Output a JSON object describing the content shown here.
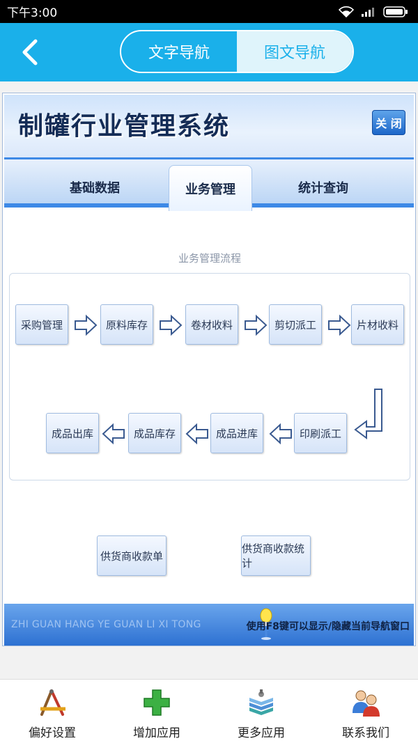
{
  "status_bar": {
    "time": "下午3:00"
  },
  "header": {
    "tabs": [
      {
        "label": "文字导航",
        "active": false
      },
      {
        "label": "图文导航",
        "active": true
      }
    ]
  },
  "system": {
    "title": "制罐行业管理系统",
    "close_label": "关 闭",
    "tabs": [
      {
        "label": "基础数据",
        "active": false
      },
      {
        "label": "业务管理",
        "active": true
      },
      {
        "label": "统计查询",
        "active": false
      }
    ],
    "flow_title": "业务管理流程",
    "row1": [
      "采购管理",
      "原料库存",
      "卷材收料",
      "剪切派工",
      "片材收料"
    ],
    "row2": [
      "印刷派工",
      "成品进库",
      "成品库存",
      "成品出库"
    ],
    "extra_buttons": [
      "供货商收款单",
      "供货商收款统计"
    ],
    "footer_left": "ZHI GUAN HANG YE GUAN LI XI TONG",
    "footer_right": "使用F8键可以显示/隐藏当前导航窗口"
  },
  "bottom_nav": [
    {
      "label": "偏好设置",
      "icon": "pencil-ruler-icon"
    },
    {
      "label": "增加应用",
      "icon": "green-plus-icon"
    },
    {
      "label": "更多应用",
      "icon": "stacked-books-icon"
    },
    {
      "label": "联系我们",
      "icon": "people-icon"
    }
  ],
  "colors": {
    "accent": "#1ab0ea",
    "system_blue": "#3d89e6"
  }
}
